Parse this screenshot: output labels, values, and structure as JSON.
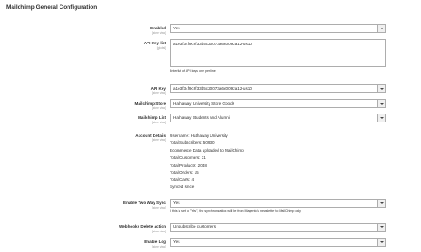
{
  "page": {
    "title": "Mailchimp General Configuration"
  },
  "fields": {
    "enabled": {
      "label": "Enabled",
      "scope": "[store view]",
      "value": "Yes"
    },
    "api_key_list": {
      "label": "API Key list",
      "scope": "[global]",
      "value": "a1e3f34f9c9f33b5c20073a6e0092a12-us10",
      "note": "Enterlist of API keys one per line"
    },
    "api_key": {
      "label": "API Key",
      "scope": "[store view]",
      "value": "a1e3f34f9c9f33b5c20073a6e0092a12-us10"
    },
    "mailchimp_store": {
      "label": "Mailchimp Store",
      "scope": "[store view]",
      "value": "Hathaway University Store Goods"
    },
    "mailchimp_list": {
      "label": "Mailchimp List",
      "scope": "[store view]",
      "value": "Hathaway Students and Alumni"
    },
    "account_details": {
      "label": "Account Details",
      "scope": "[store view]",
      "lines": [
        "Username: Hathaway University",
        "Total Subscribers: 50930",
        "Ecommerce Data uploaded to MailChimp",
        "Total Customers: 31",
        "Total Products: 2048",
        "Total Orders: 15",
        "Total Carts: 4",
        "Synced since"
      ]
    },
    "two_way_sync": {
      "label": "Enable Two Way Sync",
      "scope": "[store view]",
      "value": "Yes",
      "note": "If this is set to \"Yes\", the synchronization will be from Magento's newsletter to MailChimp only"
    },
    "webhooks_delete": {
      "label": "Webhooks Delete action",
      "scope": "[store view]",
      "value": "Unsubscribe customers"
    },
    "enable_log": {
      "label": "Enable Log",
      "scope": "[store view]",
      "value": "Yes"
    }
  }
}
